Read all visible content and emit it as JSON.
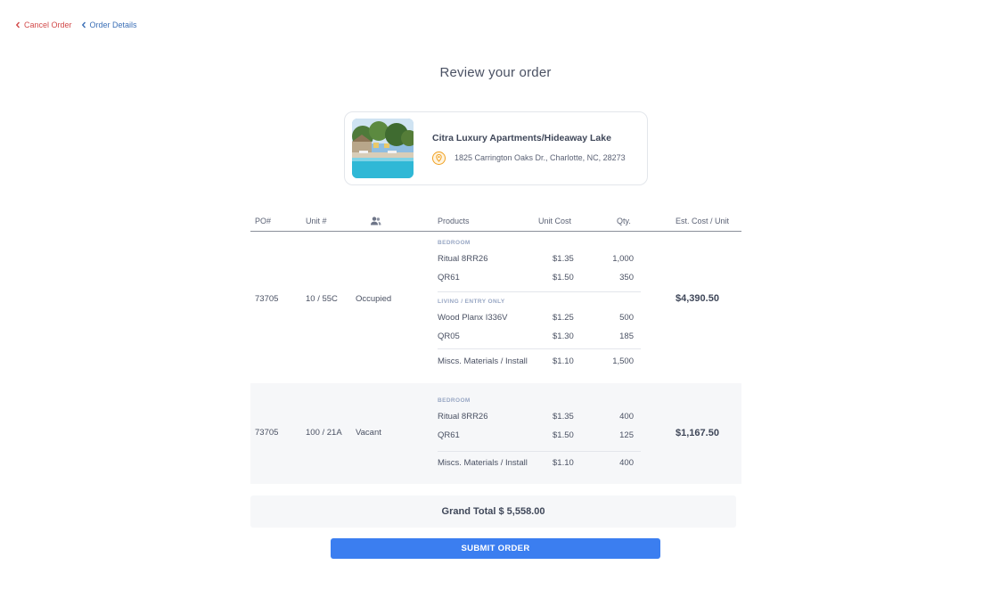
{
  "breadcrumbs": {
    "cancel_label": "Cancel Order",
    "details_label": "Order Details"
  },
  "title": "Review your order",
  "property": {
    "name": "Citra Luxury Apartments/Hideaway Lake",
    "address": "1825 Carrington Oaks Dr., Charlotte, NC, 28273"
  },
  "table": {
    "headers": {
      "po": "PO#",
      "unit": "Unit #",
      "occupancy_icon": "people-icon",
      "products": "Products",
      "unit_cost": "Unit Cost",
      "qty": "Qty.",
      "est_cost": "Est. Cost / Unit"
    },
    "rows": [
      {
        "po": "73705",
        "unit": "10 / 55C",
        "status": "Occupied",
        "est_cost": "$4,390.50",
        "groups": [
          {
            "label": "BEDROOM",
            "items": [
              {
                "name": "Ritual 8RR26",
                "cost": "$1.35",
                "qty": "1,000"
              },
              {
                "name": "QR61",
                "cost": "$1.50",
                "qty": "350"
              }
            ]
          },
          {
            "label": "LIVING / ENTRY ONLY",
            "items": [
              {
                "name": "Wood Planx I336V",
                "cost": "$1.25",
                "qty": "500"
              },
              {
                "name": "QR05",
                "cost": "$1.30",
                "qty": "185"
              }
            ]
          }
        ],
        "misc": {
          "name": "Miscs. Materials / Install",
          "cost": "$1.10",
          "qty": "1,500"
        }
      },
      {
        "po": "73705",
        "unit": "100 / 21A",
        "status": "Vacant",
        "est_cost": "$1,167.50",
        "groups": [
          {
            "label": "BEDROOM",
            "items": [
              {
                "name": "Ritual 8RR26",
                "cost": "$1.35",
                "qty": "400"
              },
              {
                "name": "QR61",
                "cost": "$1.50",
                "qty": "125"
              }
            ]
          }
        ],
        "misc": {
          "name": "Miscs. Materials / Install",
          "cost": "$1.10",
          "qty": "400"
        }
      }
    ]
  },
  "grand_total": "Grand Total $ 5,558.00",
  "submit_label": "SUBMIT ORDER",
  "colors": {
    "primary": "#3b7ef0",
    "cancel": "#d24a4a",
    "link": "#3b6fb6",
    "pin": "#f0a020"
  }
}
